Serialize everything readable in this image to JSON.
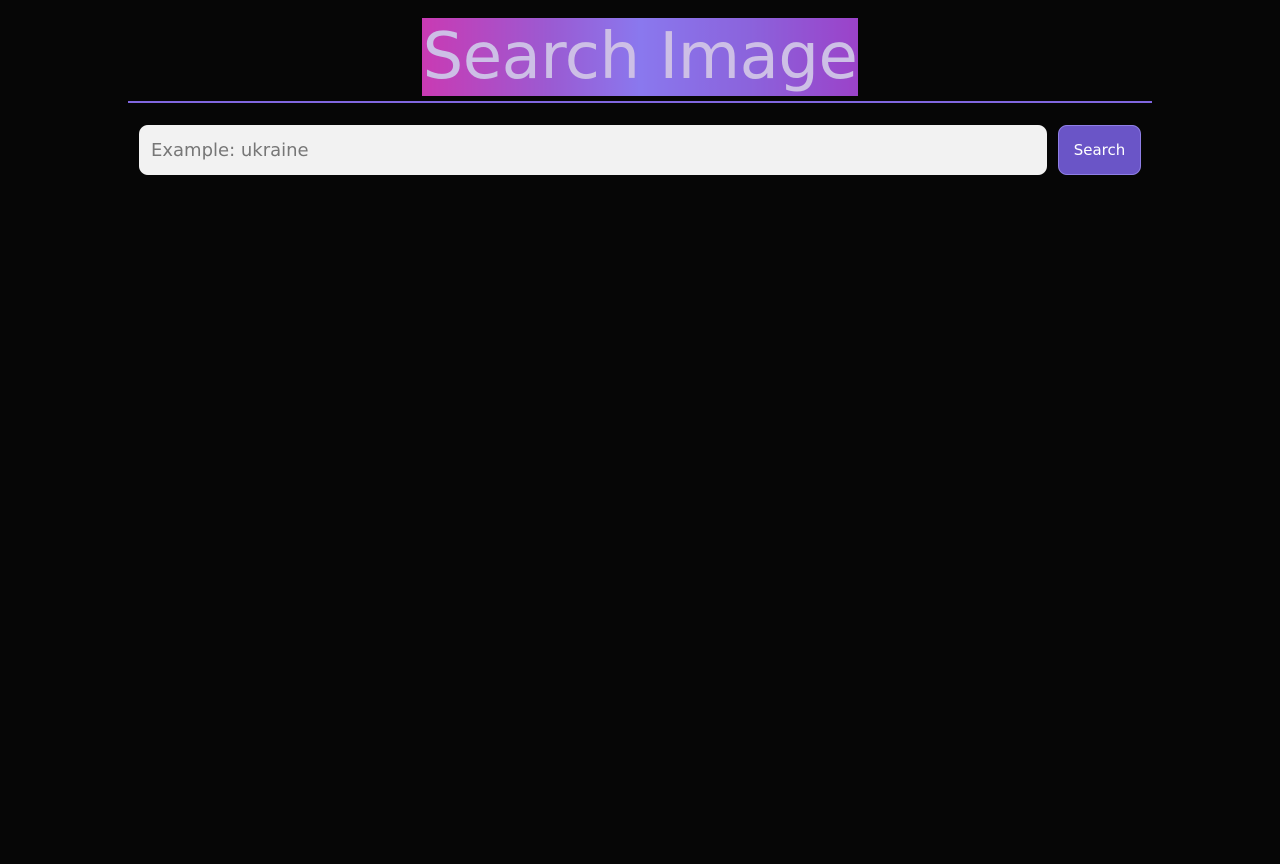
{
  "header": {
    "title": "Search Image"
  },
  "search": {
    "placeholder": "Example: ukraine",
    "value": "",
    "button_label": "Search"
  },
  "colors": {
    "background": "#060606",
    "accent": "#6a55c7",
    "divider": "#8066e0",
    "title_gradient": [
      "#c93ab3",
      "#8a78ee",
      "#9b42c9"
    ]
  }
}
